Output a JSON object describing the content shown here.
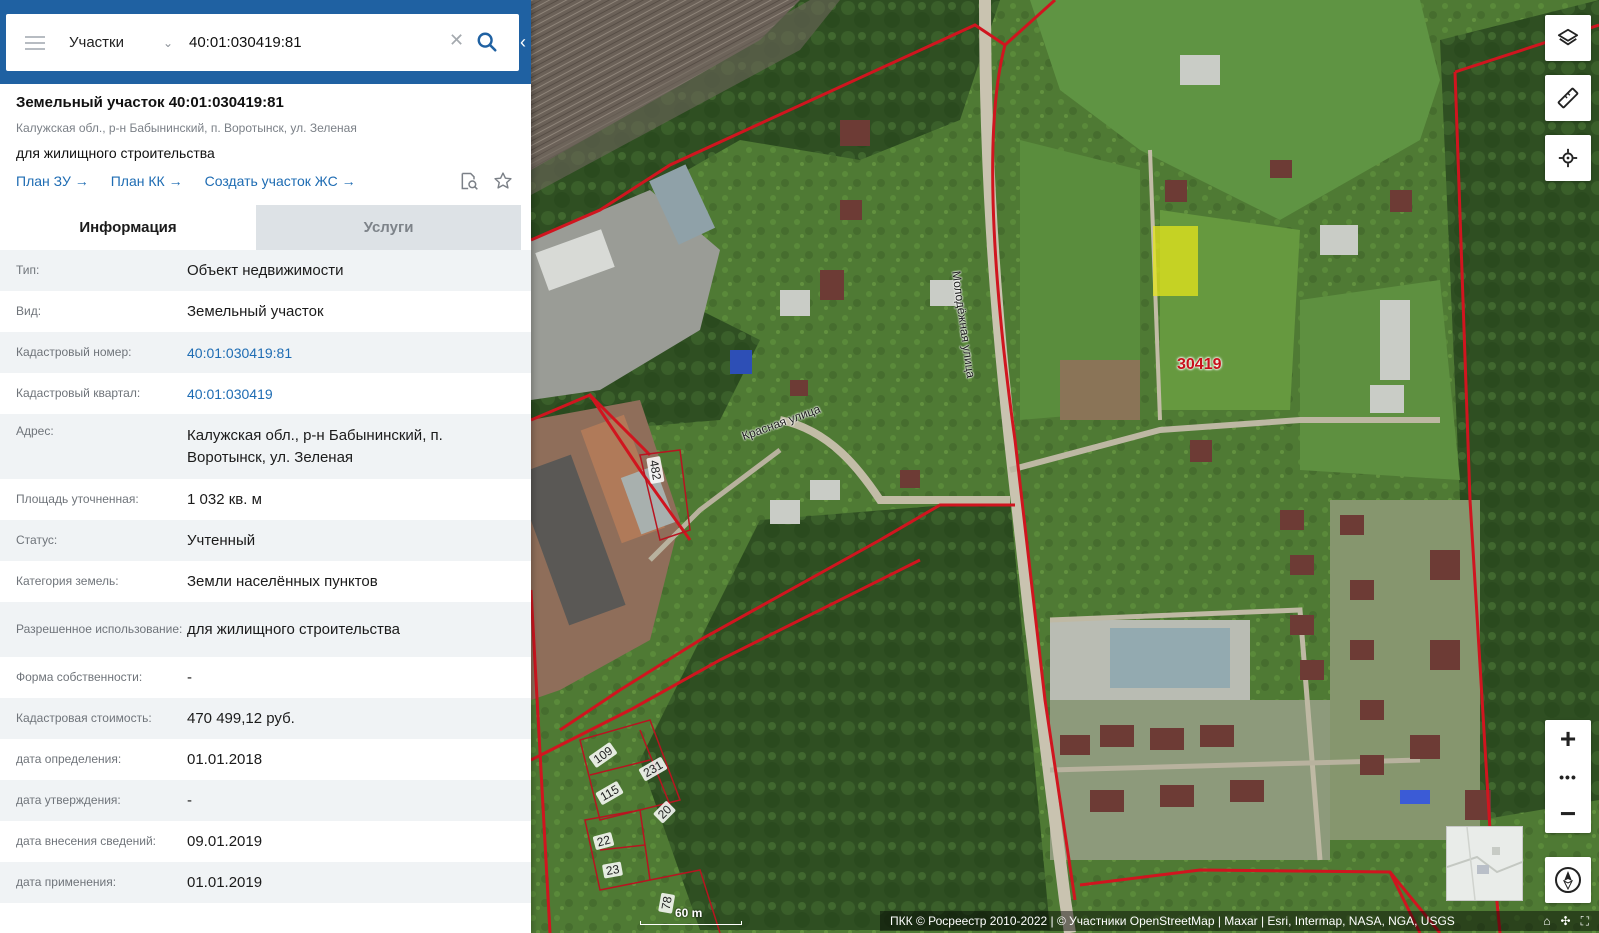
{
  "search": {
    "layer": "Участки",
    "query": "40:01:030419:81"
  },
  "object": {
    "title": "Земельный участок 40:01:030419:81",
    "address": "Калужская обл., р-н Бабынинский, п. Воротынск, ул. Зеленая",
    "use": "для жилищного строительства",
    "links": [
      "План ЗУ →",
      "План КК →",
      "Создать участок ЖС →"
    ]
  },
  "tabs": {
    "info": "Информация",
    "services": "Услуги"
  },
  "details": [
    {
      "label": "Тип:",
      "value": "Объект недвижимости"
    },
    {
      "label": "Вид:",
      "value": "Земельный участок"
    },
    {
      "label": "Кадастровый номер:",
      "value": "40:01:030419:81"
    },
    {
      "label": "Кадастровый квартал:",
      "value": "40:01:030419"
    },
    {
      "label": "Адрес:",
      "value": "Калужская обл., р-н Бабынинский, п. Воротынск, ул. Зеленая"
    },
    {
      "label": "Площадь уточненная:",
      "value": "1 032 кв. м"
    },
    {
      "label": "Статус:",
      "value": "Учтенный"
    },
    {
      "label": "Категория земель:",
      "value": "Земли населённых пунктов"
    },
    {
      "label": "Разрешенное использование:",
      "value": "для жилищного строительства"
    },
    {
      "label": "Форма собственности:",
      "value": "-"
    },
    {
      "label": "Кадастровая стоимость:",
      "value": "470 499,12 руб."
    },
    {
      "label": "дата определения:",
      "value": "01.01.2018"
    },
    {
      "label": "дата утверждения:",
      "value": "-"
    },
    {
      "label": "дата внесения сведений:",
      "value": "09.01.2019"
    },
    {
      "label": "дата применения:",
      "value": "01.01.2019"
    }
  ],
  "map": {
    "streets": [
      "Молодёжная улица",
      "Красная улица"
    ],
    "quarter_label": "30419",
    "parcel_labels": [
      "482",
      "109",
      "231",
      "115",
      "20",
      "22",
      "23",
      "78"
    ],
    "scale": "60 m",
    "attribution": "ПКК © Росреестр 2010-2022 | © Участники OpenStreetMap | Maxar | Esri, Intermap, NASA, NGA, USGS",
    "selected_color": "#e6e61c",
    "boundary_color": "#d0151f"
  },
  "controls": {
    "zoom_in": "+",
    "zoom_more": "•••",
    "zoom_out": "−"
  }
}
